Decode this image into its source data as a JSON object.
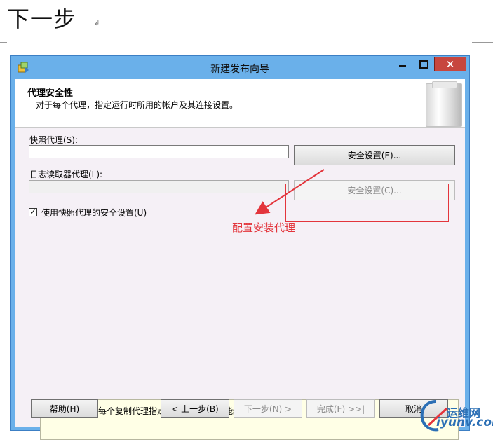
{
  "doc": {
    "heading": "下一步",
    "para_mark": "↲"
  },
  "window": {
    "title": "新建发布向导",
    "close_glyph": "✕"
  },
  "header": {
    "title": "代理安全性",
    "subtitle": "对于每个代理，指定运行时所用的帐户及其连接设置。"
  },
  "snapshot_agent": {
    "label": "快照代理(S):",
    "value": "",
    "security_button": "安全设置(E)..."
  },
  "logreader_agent": {
    "label": "日志读取器代理(L):",
    "value": "",
    "security_button": "安全设置(C)..."
  },
  "use_snapshot_checkbox": {
    "label": "使用快照代理的安全设置(U)",
    "checked": true
  },
  "annotation": {
    "text": "配置安装代理",
    "color": "#e3353c"
  },
  "warning": {
    "text": "必须先为每个复制代理指定登录名，然后才能继续执行该向导。"
  },
  "footer": {
    "help": "帮助(H)",
    "back": "< 上一步(B)",
    "next": "下一步(N) >",
    "finish": "完成(F) >>|",
    "cancel": "取消"
  },
  "watermark": {
    "line1": "运维网",
    "line2": "iyunv.com"
  },
  "colors": {
    "titlebar": "#6ab0ea",
    "close": "#c7463e",
    "accent": "#3c7fc4"
  }
}
